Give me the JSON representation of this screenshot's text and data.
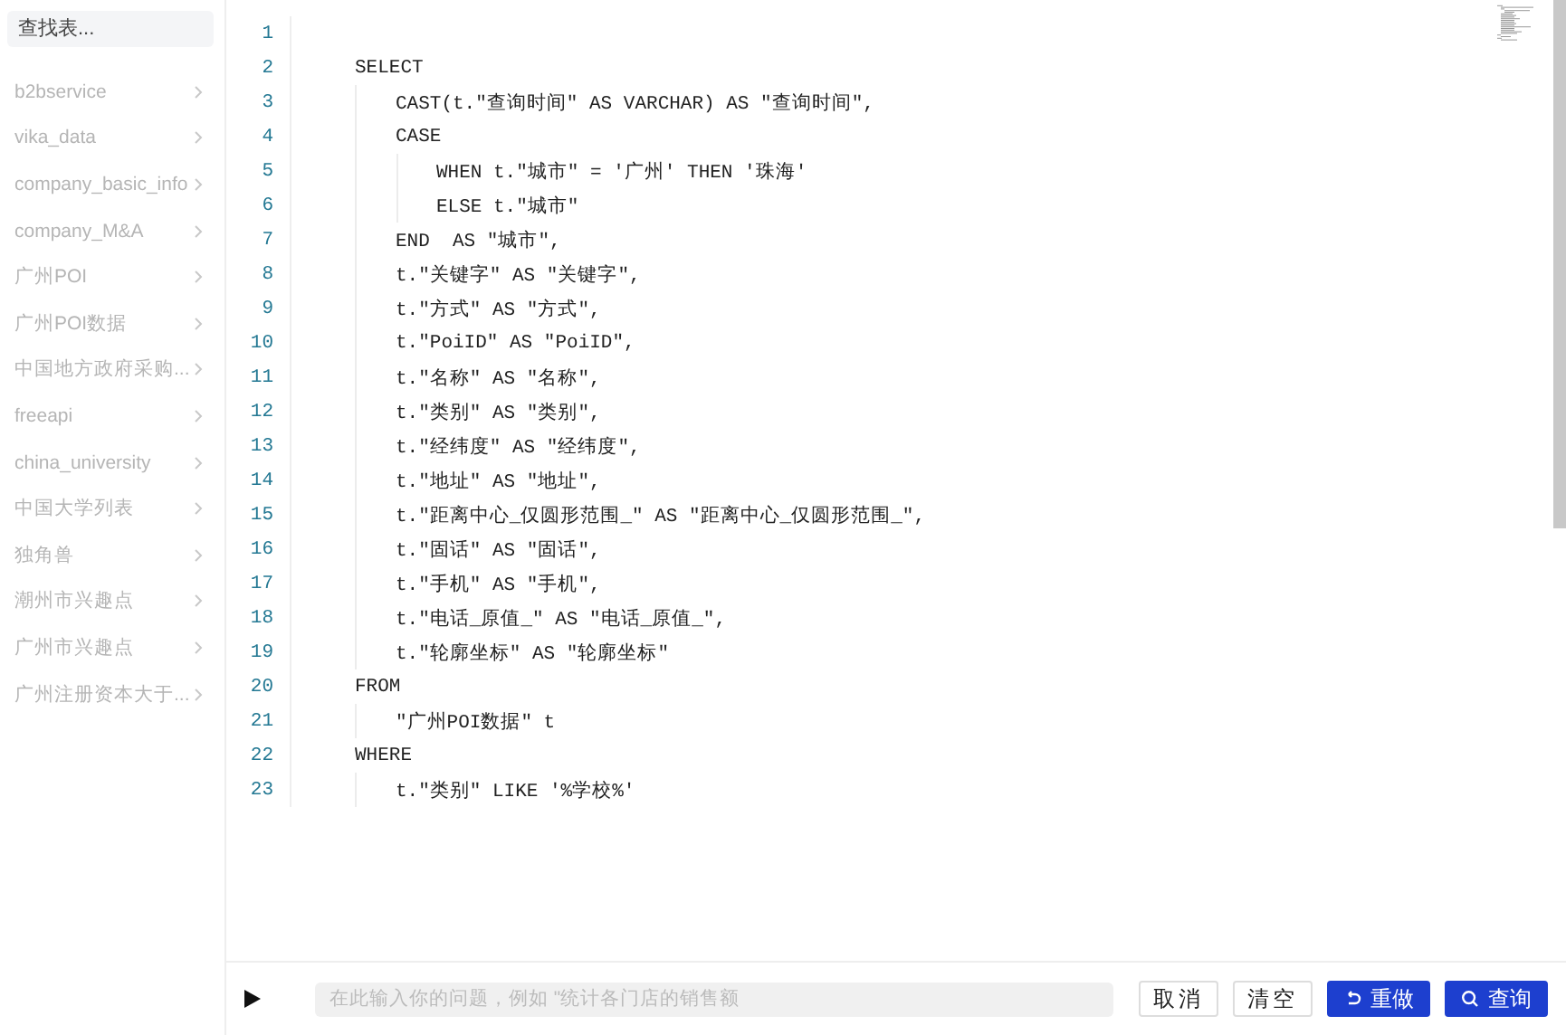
{
  "sidebar": {
    "search": {
      "placeholder": "查找表..."
    },
    "items": [
      {
        "label": "b2bservice"
      },
      {
        "label": "vika_data"
      },
      {
        "label": "company_basic_info"
      },
      {
        "label": "company_M&A"
      },
      {
        "label": "广州POI"
      },
      {
        "label": "广州POI数据"
      },
      {
        "label": "中国地方政府采购..."
      },
      {
        "label": "freeapi"
      },
      {
        "label": "china_university"
      },
      {
        "label": "中国大学列表"
      },
      {
        "label": "独角兽"
      },
      {
        "label": "潮州市兴趣点"
      },
      {
        "label": "广州市兴趣点"
      },
      {
        "label": "广州注册资本大于..."
      }
    ]
  },
  "editor": {
    "lines": [
      {
        "number": "1"
      },
      {
        "number": "2",
        "text": "SELECT",
        "children": [
          {
            "number": "3",
            "text": "CAST(t.\"查询时间\" AS VARCHAR) AS \"查询时间\","
          },
          {
            "number": "4",
            "text": "CASE",
            "children": [
              {
                "number": "5",
                "text": "WHEN t.\"城市\" = '广州' THEN '珠海'"
              },
              {
                "number": "6",
                "text": "ELSE t.\"城市\""
              }
            ]
          },
          {
            "number": "7",
            "text": "END  AS \"城市\","
          },
          {
            "number": "8",
            "text": "t.\"关键字\" AS \"关键字\","
          },
          {
            "number": "9",
            "text": "t.\"方式\" AS \"方式\","
          },
          {
            "number": "10",
            "text": "t.\"PoiID\" AS \"PoiID\","
          },
          {
            "number": "11",
            "text": "t.\"名称\" AS \"名称\","
          },
          {
            "number": "12",
            "text": "t.\"类别\" AS \"类别\","
          },
          {
            "number": "13",
            "text": "t.\"经纬度\" AS \"经纬度\","
          },
          {
            "number": "14",
            "text": "t.\"地址\" AS \"地址\","
          },
          {
            "number": "15",
            "text": "t.\"距离中心_仅圆形范围_\" AS \"距离中心_仅圆形范围_\","
          },
          {
            "number": "16",
            "text": "t.\"固话\" AS \"固话\","
          },
          {
            "number": "17",
            "text": "t.\"手机\" AS \"手机\","
          },
          {
            "number": "18",
            "text": "t.\"电话_原值_\" AS \"电话_原值_\","
          },
          {
            "number": "19",
            "text": "t.\"轮廓坐标\" AS \"轮廓坐标\""
          }
        ]
      },
      {
        "number": "20",
        "text": "FROM",
        "children": [
          {
            "number": "21",
            "text": "\"广州POI数据\" t"
          }
        ]
      },
      {
        "number": "22",
        "text": "WHERE",
        "children": [
          {
            "number": "23",
            "text": "t.\"类别\" LIKE '%学校%'"
          }
        ]
      }
    ]
  },
  "query_bar": {
    "placeholder": "在此输入你的问题，例如 \"统计各门店的销售额",
    "buttons": [
      {
        "label": "取消",
        "kind": "plain"
      },
      {
        "label": "清空",
        "kind": "plain"
      },
      {
        "label": "重做",
        "kind": "undo"
      },
      {
        "label": "查询",
        "kind": "search"
      }
    ]
  }
}
